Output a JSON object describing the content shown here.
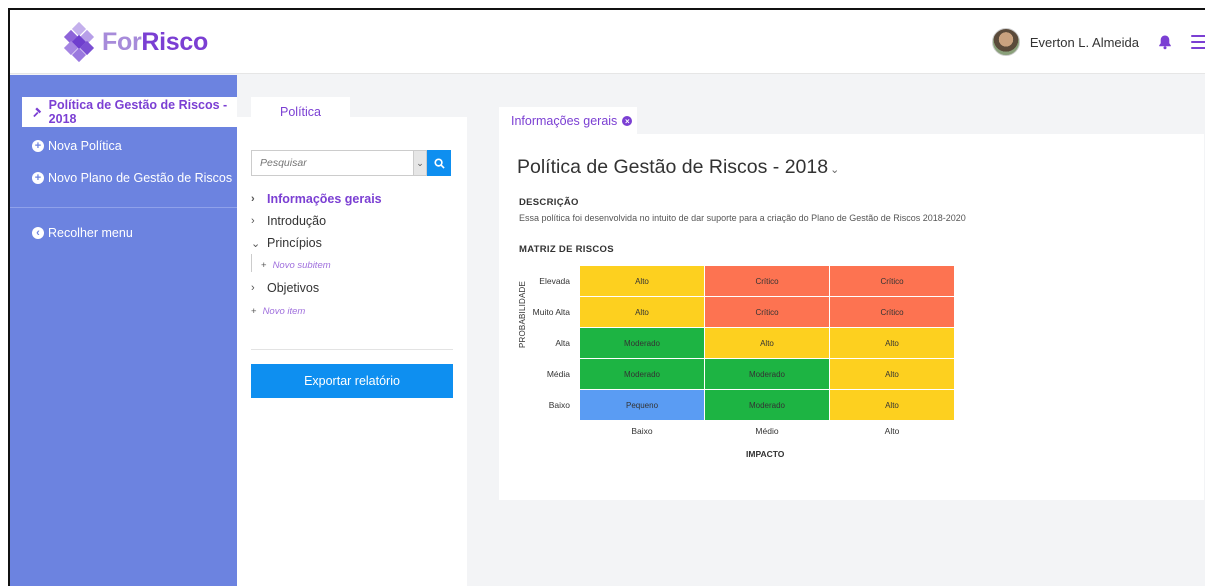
{
  "brand": {
    "for": "For",
    "risco": "Risco"
  },
  "header": {
    "user_name": "Everton L. Almeida"
  },
  "sidebar": {
    "active": "Política de Gestão de Riscos - 2018",
    "items": [
      {
        "label": "Nova Política"
      },
      {
        "label": "Novo Plano de Gestão de Riscos"
      },
      {
        "label": "Recolher menu"
      }
    ]
  },
  "middle": {
    "tab": "Política",
    "search_placeholder": "Pesquisar",
    "nav": [
      {
        "label": "Informações gerais"
      },
      {
        "label": "Introdução"
      },
      {
        "label": "Princípios"
      },
      {
        "label": "Novo subitem"
      },
      {
        "label": "Objetivos"
      },
      {
        "label": "Novo item"
      }
    ],
    "export_label": "Exportar relatório"
  },
  "content": {
    "tab": "Informações gerais",
    "title": "Política de Gestão de Riscos - 2018",
    "desc_label": "DESCRIÇÃO",
    "desc_text": "Essa política foi desenvolvida no intuito de dar suporte para a criação do Plano de Gestão de Riscos 2018-2020",
    "matrix_label": "MATRIZ DE RISCOS",
    "matrix": {
      "y_axis": "PROBABILIDADE",
      "x_axis": "IMPACTO",
      "rows": [
        "Elevada",
        "Muito Alta",
        "Alta",
        "Média",
        "Baixo"
      ],
      "cols": [
        "Baixo",
        "Médio",
        "Alto"
      ],
      "cells": [
        [
          "Alto",
          "Crítico",
          "Crítico"
        ],
        [
          "Alto",
          "Crítico",
          "Crítico"
        ],
        [
          "Moderado",
          "Alto",
          "Alto"
        ],
        [
          "Moderado",
          "Moderado",
          "Alto"
        ],
        [
          "Pequeno",
          "Moderado",
          "Alto"
        ]
      ],
      "colors": {
        "Alto": "#fdd01f",
        "Crítico": "#fd7351",
        "Moderado": "#1db443",
        "Pequeno": "#5a9cf3"
      }
    }
  },
  "colors": {
    "accent": "#7b3fd3",
    "sidebar": "#6c83e0",
    "button": "#0e8ff0"
  }
}
